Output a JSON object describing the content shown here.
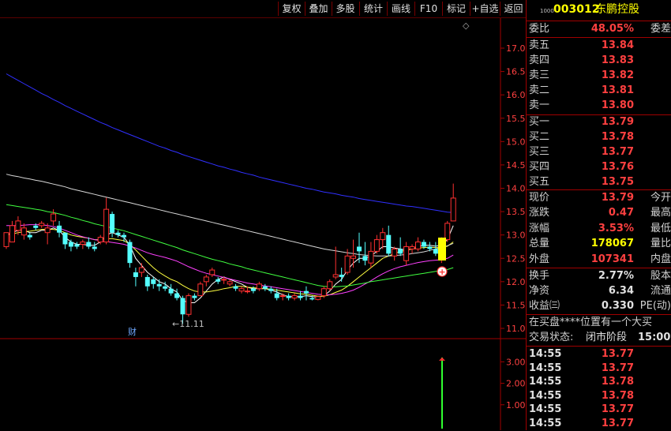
{
  "toolbar": {
    "items": [
      "复权",
      "叠加",
      "多股",
      "统计",
      "画线",
      "F10",
      "标记",
      "+自选",
      "返回"
    ]
  },
  "stock": {
    "code_prefix": "1000",
    "code": "003012",
    "name": "东鹏控股"
  },
  "panel": {
    "weibi": {
      "label": "委比",
      "value": "48.05%",
      "label2": "委差"
    },
    "asks": [
      {
        "label": "卖五",
        "price": "13.84"
      },
      {
        "label": "卖四",
        "price": "13.83"
      },
      {
        "label": "卖三",
        "price": "13.82"
      },
      {
        "label": "卖二",
        "price": "13.81"
      },
      {
        "label": "卖一",
        "price": "13.80"
      }
    ],
    "bids": [
      {
        "label": "买一",
        "price": "13.79"
      },
      {
        "label": "买二",
        "price": "13.78"
      },
      {
        "label": "买三",
        "price": "13.77"
      },
      {
        "label": "买四",
        "price": "13.76"
      },
      {
        "label": "买五",
        "price": "13.75"
      }
    ],
    "quote": [
      {
        "label": "现价",
        "value": "13.79",
        "label2": "今开",
        "color": "#ff4040"
      },
      {
        "label": "涨跌",
        "value": "0.47",
        "label2": "最高",
        "color": "#ff4040"
      },
      {
        "label": "涨幅",
        "value": "3.53%",
        "label2": "最低",
        "color": "#ff4040"
      },
      {
        "label": "总量",
        "value": "178067",
        "label2": "量比",
        "color": "#ffff00"
      },
      {
        "label": "外盘",
        "value": "107341",
        "label2": "内盘",
        "color": "#ff4040"
      }
    ],
    "stats": [
      {
        "label": "换手",
        "value": "2.77%",
        "label2": "股本"
      },
      {
        "label": "净资",
        "value": "6.34",
        "label2": "流通"
      },
      {
        "label": "收益㈢",
        "value": "0.330",
        "label2": "PE(动)"
      }
    ],
    "notice": "在买盘****位置有一个大买",
    "status_label": "交易状态:",
    "status_value": "闭市阶段",
    "status_time": "15:00:",
    "ticks": [
      {
        "time": "14:55",
        "price": "13.77"
      },
      {
        "time": "14:55",
        "price": "13.77"
      },
      {
        "time": "14:55",
        "price": "13.78"
      },
      {
        "time": "14:55",
        "price": "13.78"
      },
      {
        "time": "14:55",
        "price": "13.77"
      },
      {
        "time": "14:55",
        "price": "13.77"
      }
    ]
  },
  "chart_data": {
    "type": "candlestick",
    "price_axis_ticks": [
      "17.00",
      "16.50",
      "16.00",
      "15.50",
      "15.00",
      "14.50",
      "14.00",
      "13.50",
      "13.00",
      "12.50",
      "12.00",
      "11.50",
      "11.00"
    ],
    "volume_axis_ticks": [
      "3.00",
      "2.00",
      "1.00"
    ],
    "low_label": "11.11",
    "finance_marker": "财",
    "ylim": [
      10.8,
      17.35
    ],
    "candles": [
      [
        12.75,
        13.05,
        12.7,
        13.05
      ],
      [
        12.85,
        13.3,
        12.85,
        13.2
      ],
      [
        13.1,
        13.4,
        13.0,
        13.3
      ],
      [
        13.0,
        13.25,
        12.9,
        13.15
      ],
      [
        13.0,
        13.05,
        12.9,
        12.95
      ],
      [
        13.2,
        13.25,
        13.1,
        13.15
      ],
      [
        13.2,
        13.3,
        13.15,
        13.25
      ],
      [
        13.05,
        13.25,
        12.8,
        13.15
      ],
      [
        13.3,
        13.55,
        13.2,
        13.45
      ],
      [
        13.2,
        13.3,
        12.95,
        13.05
      ],
      [
        13.05,
        13.05,
        12.7,
        12.8
      ],
      [
        12.85,
        12.9,
        12.65,
        12.75
      ],
      [
        12.8,
        12.85,
        12.7,
        12.75
      ],
      [
        12.8,
        12.9,
        12.7,
        12.85
      ],
      [
        12.85,
        12.95,
        12.7,
        12.75
      ],
      [
        12.75,
        12.85,
        12.65,
        12.7
      ],
      [
        12.85,
        13.0,
        12.8,
        12.95
      ],
      [
        12.85,
        13.8,
        12.8,
        13.55
      ],
      [
        13.45,
        13.5,
        12.95,
        13.05
      ],
      [
        13.05,
        13.1,
        12.95,
        13.0
      ],
      [
        13.0,
        13.05,
        12.85,
        12.95
      ],
      [
        12.85,
        12.9,
        12.3,
        12.4
      ],
      [
        12.2,
        12.3,
        11.9,
        12.1
      ],
      [
        12.2,
        12.4,
        12.1,
        12.3
      ],
      [
        12.1,
        12.15,
        11.8,
        11.9
      ],
      [
        12.05,
        12.1,
        11.85,
        11.95
      ],
      [
        11.95,
        12.05,
        11.8,
        11.9
      ],
      [
        11.9,
        12.0,
        11.8,
        11.85
      ],
      [
        11.85,
        11.95,
        11.7,
        11.75
      ],
      [
        11.75,
        11.85,
        11.6,
        11.65
      ],
      [
        11.65,
        11.7,
        11.1,
        11.3
      ],
      [
        11.3,
        11.75,
        11.25,
        11.7
      ],
      [
        11.7,
        11.75,
        11.6,
        11.65
      ],
      [
        11.7,
        12.0,
        11.7,
        11.95
      ],
      [
        12.0,
        12.15,
        11.9,
        12.1
      ],
      [
        12.15,
        12.3,
        12.1,
        12.25
      ],
      [
        12.05,
        12.1,
        11.95,
        12.0
      ],
      [
        12.05,
        12.1,
        11.95,
        12.05
      ],
      [
        11.95,
        12.05,
        11.9,
        12.0
      ],
      [
        11.9,
        11.95,
        11.8,
        11.85
      ],
      [
        11.8,
        11.9,
        11.75,
        11.85
      ],
      [
        11.8,
        11.9,
        11.75,
        11.8
      ],
      [
        11.85,
        11.9,
        11.75,
        11.8
      ],
      [
        11.85,
        12.0,
        11.8,
        11.95
      ],
      [
        11.9,
        11.95,
        11.8,
        11.85
      ],
      [
        11.85,
        11.9,
        11.75,
        11.8
      ],
      [
        11.75,
        11.85,
        11.6,
        11.65
      ],
      [
        11.7,
        11.75,
        11.6,
        11.7
      ],
      [
        11.7,
        11.75,
        11.6,
        11.65
      ],
      [
        11.65,
        11.75,
        11.6,
        11.7
      ],
      [
        11.7,
        11.8,
        11.6,
        11.65
      ],
      [
        11.8,
        11.9,
        11.6,
        11.75
      ],
      [
        11.65,
        11.7,
        11.6,
        11.62
      ],
      [
        11.62,
        11.7,
        11.6,
        11.68
      ],
      [
        11.7,
        11.9,
        11.65,
        11.85
      ],
      [
        11.85,
        12.05,
        11.8,
        12.0
      ],
      [
        12.1,
        12.75,
        12.05,
        12.15
      ],
      [
        12.15,
        12.3,
        12.0,
        12.1
      ],
      [
        12.2,
        12.7,
        12.15,
        12.55
      ],
      [
        12.5,
        12.9,
        12.3,
        12.55
      ],
      [
        12.75,
        13.05,
        12.4,
        12.65
      ],
      [
        12.55,
        12.85,
        12.35,
        12.45
      ],
      [
        12.4,
        12.85,
        12.3,
        12.65
      ],
      [
        12.65,
        13.0,
        12.6,
        12.9
      ],
      [
        12.9,
        13.15,
        12.7,
        13.05
      ],
      [
        13.0,
        13.2,
        12.55,
        12.6
      ],
      [
        12.55,
        12.75,
        12.45,
        12.7
      ],
      [
        12.7,
        12.95,
        12.55,
        12.6
      ],
      [
        12.45,
        12.85,
        12.35,
        12.75
      ],
      [
        12.7,
        12.8,
        12.6,
        12.75
      ],
      [
        12.7,
        12.95,
        12.65,
        12.85
      ],
      [
        12.85,
        12.9,
        12.7,
        12.75
      ],
      [
        12.75,
        12.85,
        12.65,
        12.7
      ],
      [
        12.7,
        12.85,
        12.55,
        12.6
      ],
      [
        12.55,
        12.95,
        12.4,
        12.9
      ],
      [
        12.9,
        13.3,
        12.85,
        13.25
      ],
      [
        13.3,
        14.1,
        13.3,
        13.79
      ]
    ],
    "ma_series": [
      {
        "color": "#ffffff",
        "values": [
          13.0,
          13.05,
          13.1,
          13.1,
          13.05,
          13.05,
          13.1,
          13.1,
          13.15,
          13.1,
          12.95,
          12.85,
          12.8,
          12.8,
          12.78,
          12.78,
          12.85,
          13.0,
          13.05,
          13.0,
          12.95,
          12.78,
          12.5,
          12.35,
          12.2,
          12.1,
          12.0,
          11.95,
          11.85,
          11.78,
          11.6,
          11.55,
          11.55,
          11.65,
          11.8,
          11.95,
          12.05,
          12.1,
          12.05,
          12.0,
          11.95,
          11.88,
          11.85,
          11.85,
          11.85,
          11.82,
          11.78,
          11.72,
          11.68,
          11.68,
          11.68,
          11.7,
          11.68,
          11.67,
          11.7,
          11.8,
          11.95,
          12.05,
          12.25,
          12.4,
          12.5,
          12.5,
          12.55,
          12.65,
          12.75,
          12.75,
          12.72,
          12.7,
          12.68,
          12.7,
          12.75,
          12.78,
          12.78,
          12.76,
          12.78,
          12.9,
          13.2
        ]
      },
      {
        "color": "#ffff40",
        "values": [
          13.0,
          13.02,
          13.05,
          13.07,
          13.08,
          13.1,
          13.12,
          13.12,
          13.12,
          13.1,
          13.05,
          13.0,
          12.97,
          12.95,
          12.93,
          12.9,
          12.9,
          12.92,
          12.92,
          12.9,
          12.88,
          12.8,
          12.68,
          12.55,
          12.42,
          12.3,
          12.2,
          12.12,
          12.05,
          12.0,
          11.92,
          11.85,
          11.8,
          11.78,
          11.78,
          11.8,
          11.82,
          11.85,
          11.87,
          11.9,
          11.9,
          11.88,
          11.87,
          11.86,
          11.85,
          11.84,
          11.82,
          11.8,
          11.78,
          11.76,
          11.74,
          11.73,
          11.71,
          11.69,
          11.69,
          11.72,
          11.77,
          11.82,
          11.9,
          12.0,
          12.1,
          12.2,
          12.3,
          12.4,
          12.5,
          12.55,
          12.6,
          12.65,
          12.67,
          12.7,
          12.72,
          12.73,
          12.74,
          12.73,
          12.73,
          12.76,
          12.85
        ]
      },
      {
        "color": "#ff40ff",
        "values": [
          13.2,
          13.2,
          13.2,
          13.21,
          13.22,
          13.22,
          13.22,
          13.2,
          13.18,
          13.15,
          13.1,
          13.05,
          13.0,
          12.96,
          12.93,
          12.9,
          12.88,
          12.86,
          12.84,
          12.82,
          12.8,
          12.76,
          12.72,
          12.67,
          12.62,
          12.58,
          12.55,
          12.52,
          12.48,
          12.44,
          12.38,
          12.32,
          12.27,
          12.22,
          12.18,
          12.15,
          12.12,
          12.09,
          12.06,
          12.03,
          12.0,
          11.97,
          11.95,
          11.93,
          11.91,
          11.89,
          11.87,
          11.85,
          11.83,
          11.81,
          11.79,
          11.77,
          11.75,
          11.73,
          11.72,
          11.72,
          11.73,
          11.75,
          11.78,
          11.82,
          11.88,
          11.95,
          12.02,
          12.1,
          12.17,
          12.23,
          12.28,
          12.32,
          12.35,
          12.38,
          12.41,
          12.43,
          12.45,
          12.46,
          12.47,
          12.5,
          12.57
        ]
      },
      {
        "color": "#40ff40",
        "values": [
          13.65,
          13.63,
          13.61,
          13.59,
          13.57,
          13.55,
          13.53,
          13.5,
          13.48,
          13.45,
          13.42,
          13.38,
          13.35,
          13.31,
          13.28,
          13.24,
          13.21,
          13.18,
          13.15,
          13.12,
          13.09,
          13.05,
          13.01,
          12.97,
          12.93,
          12.89,
          12.85,
          12.81,
          12.77,
          12.73,
          12.68,
          12.64,
          12.6,
          12.56,
          12.52,
          12.48,
          12.45,
          12.42,
          12.38,
          12.35,
          12.32,
          12.28,
          12.25,
          12.22,
          12.19,
          12.16,
          12.13,
          12.1,
          12.07,
          12.04,
          12.01,
          11.98,
          11.95,
          11.92,
          11.9,
          11.89,
          11.89,
          11.9,
          11.91,
          11.93,
          11.95,
          11.97,
          12.0,
          12.02,
          12.04,
          12.06,
          12.08,
          12.1,
          12.12,
          12.14,
          12.16,
          12.18,
          12.2,
          12.22,
          12.24,
          12.26,
          12.3
        ]
      },
      {
        "color": "#d8d8d8",
        "values": [
          14.3,
          14.27,
          14.25,
          14.22,
          14.2,
          14.17,
          14.15,
          14.12,
          14.09,
          14.06,
          14.03,
          13.99,
          13.96,
          13.93,
          13.9,
          13.87,
          13.84,
          13.81,
          13.78,
          13.75,
          13.72,
          13.69,
          13.66,
          13.63,
          13.6,
          13.57,
          13.54,
          13.51,
          13.48,
          13.45,
          13.42,
          13.39,
          13.36,
          13.33,
          13.3,
          13.27,
          13.24,
          13.21,
          13.18,
          13.15,
          13.12,
          13.09,
          13.06,
          13.03,
          13.0,
          12.97,
          12.94,
          12.91,
          12.88,
          12.85,
          12.82,
          12.79,
          12.76,
          12.73,
          12.7,
          12.68,
          12.66,
          12.64,
          12.62,
          12.6,
          12.58,
          12.57,
          12.56,
          12.55,
          12.55,
          12.55,
          12.56,
          12.57,
          12.58,
          12.6,
          12.62,
          12.64,
          12.67,
          12.7,
          12.73,
          12.77,
          12.82
        ]
      },
      {
        "color": "#3030ff",
        "values": [
          16.45,
          16.38,
          16.31,
          16.24,
          16.17,
          16.1,
          16.03,
          15.97,
          15.9,
          15.84,
          15.77,
          15.71,
          15.65,
          15.59,
          15.53,
          15.47,
          15.41,
          15.36,
          15.3,
          15.25,
          15.2,
          15.15,
          15.1,
          15.05,
          15.0,
          14.95,
          14.9,
          14.86,
          14.81,
          14.77,
          14.72,
          14.68,
          14.64,
          14.6,
          14.56,
          14.52,
          14.48,
          14.45,
          14.41,
          14.38,
          14.34,
          14.31,
          14.28,
          14.24,
          14.21,
          14.18,
          14.15,
          14.12,
          14.09,
          14.06,
          14.03,
          14.0,
          13.98,
          13.95,
          13.92,
          13.9,
          13.88,
          13.85,
          13.83,
          13.81,
          13.78,
          13.76,
          13.74,
          13.72,
          13.7,
          13.68,
          13.66,
          13.64,
          13.62,
          13.61,
          13.59,
          13.57,
          13.55,
          13.53,
          13.51,
          13.49,
          13.48
        ]
      }
    ],
    "volume": {
      "values": [
        3.2
      ],
      "ylim": [
        0,
        3.6
      ]
    }
  }
}
